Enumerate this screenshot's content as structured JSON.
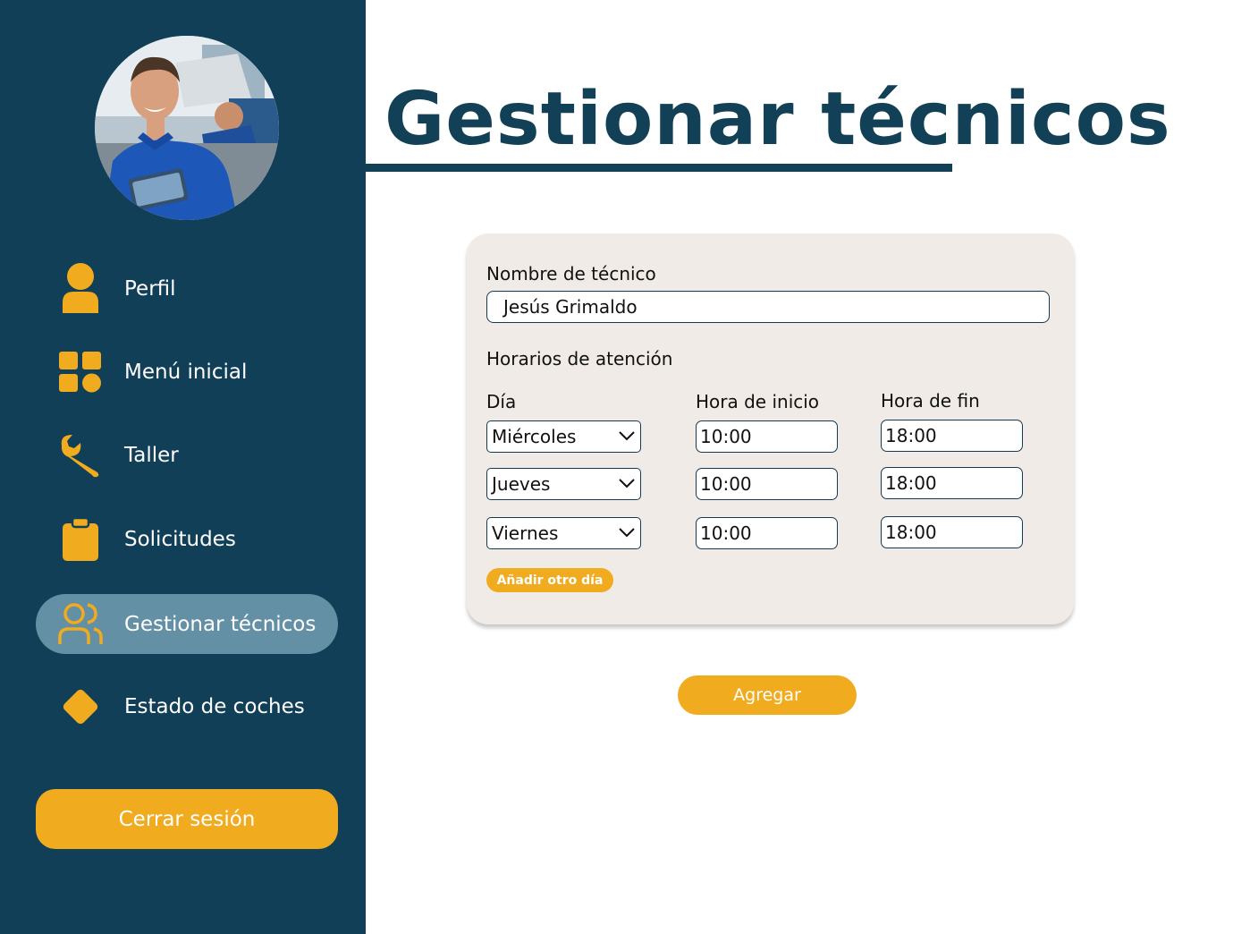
{
  "sidebar": {
    "nav": [
      {
        "label": "Perfil",
        "icon": "person-icon"
      },
      {
        "label": "Menú inicial",
        "icon": "grid-icon"
      },
      {
        "label": "Taller",
        "icon": "wrench-icon"
      },
      {
        "label": "Solicitudes",
        "icon": "clipboard-icon"
      },
      {
        "label": "Gestionar técnicos",
        "icon": "users-icon",
        "active": true
      },
      {
        "label": "Estado de coches",
        "icon": "diamond-icon"
      }
    ],
    "logout_label": "Cerrar sesión"
  },
  "page": {
    "title": "Gestionar técnicos"
  },
  "form": {
    "name_label": "Nombre de técnico",
    "name_value": "Jesús Grimaldo",
    "schedule_label": "Horarios de atención",
    "columns": {
      "day": "Día",
      "start": "Hora de inicio",
      "end": "Hora de fin"
    },
    "rows": [
      {
        "day": "Miércoles",
        "start": "10:00",
        "end": "18:00"
      },
      {
        "day": "Jueves",
        "start": "10:00",
        "end": "18:00"
      },
      {
        "day": "Viernes",
        "start": "10:00",
        "end": "18:00"
      }
    ],
    "add_day_label": "Añadir otro día"
  },
  "submit_label": "Agregar",
  "colors": {
    "sidebar": "#103f57",
    "active_item": "#6390a4",
    "accent": "#f0ab1f",
    "title": "#124056",
    "card": "#f0ebe6"
  }
}
